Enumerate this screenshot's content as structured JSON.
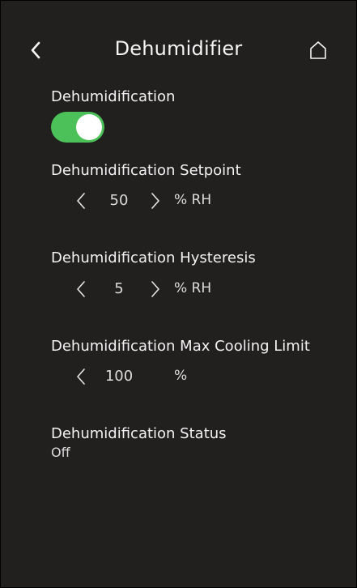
{
  "header": {
    "title": "Dehumidifier",
    "back_icon": "chevron-left-icon",
    "home_icon": "home-icon"
  },
  "dehumidification": {
    "label": "Dehumidification",
    "enabled": true,
    "toggle_color": "#4cc159"
  },
  "setpoint": {
    "label": "Dehumidification Setpoint",
    "value": "50",
    "unit": "% RH"
  },
  "hysteresis": {
    "label": "Dehumidification Hysteresis",
    "value": "5",
    "unit": "% RH"
  },
  "max_cooling_limit": {
    "label": "Dehumidification Max Cooling Limit",
    "value": "100",
    "unit": "%"
  },
  "status": {
    "label": "Dehumidification Status",
    "value": "Off"
  },
  "colors": {
    "background": "#221f1f",
    "text": "#f2f2f2",
    "accent": "#4cc159"
  }
}
